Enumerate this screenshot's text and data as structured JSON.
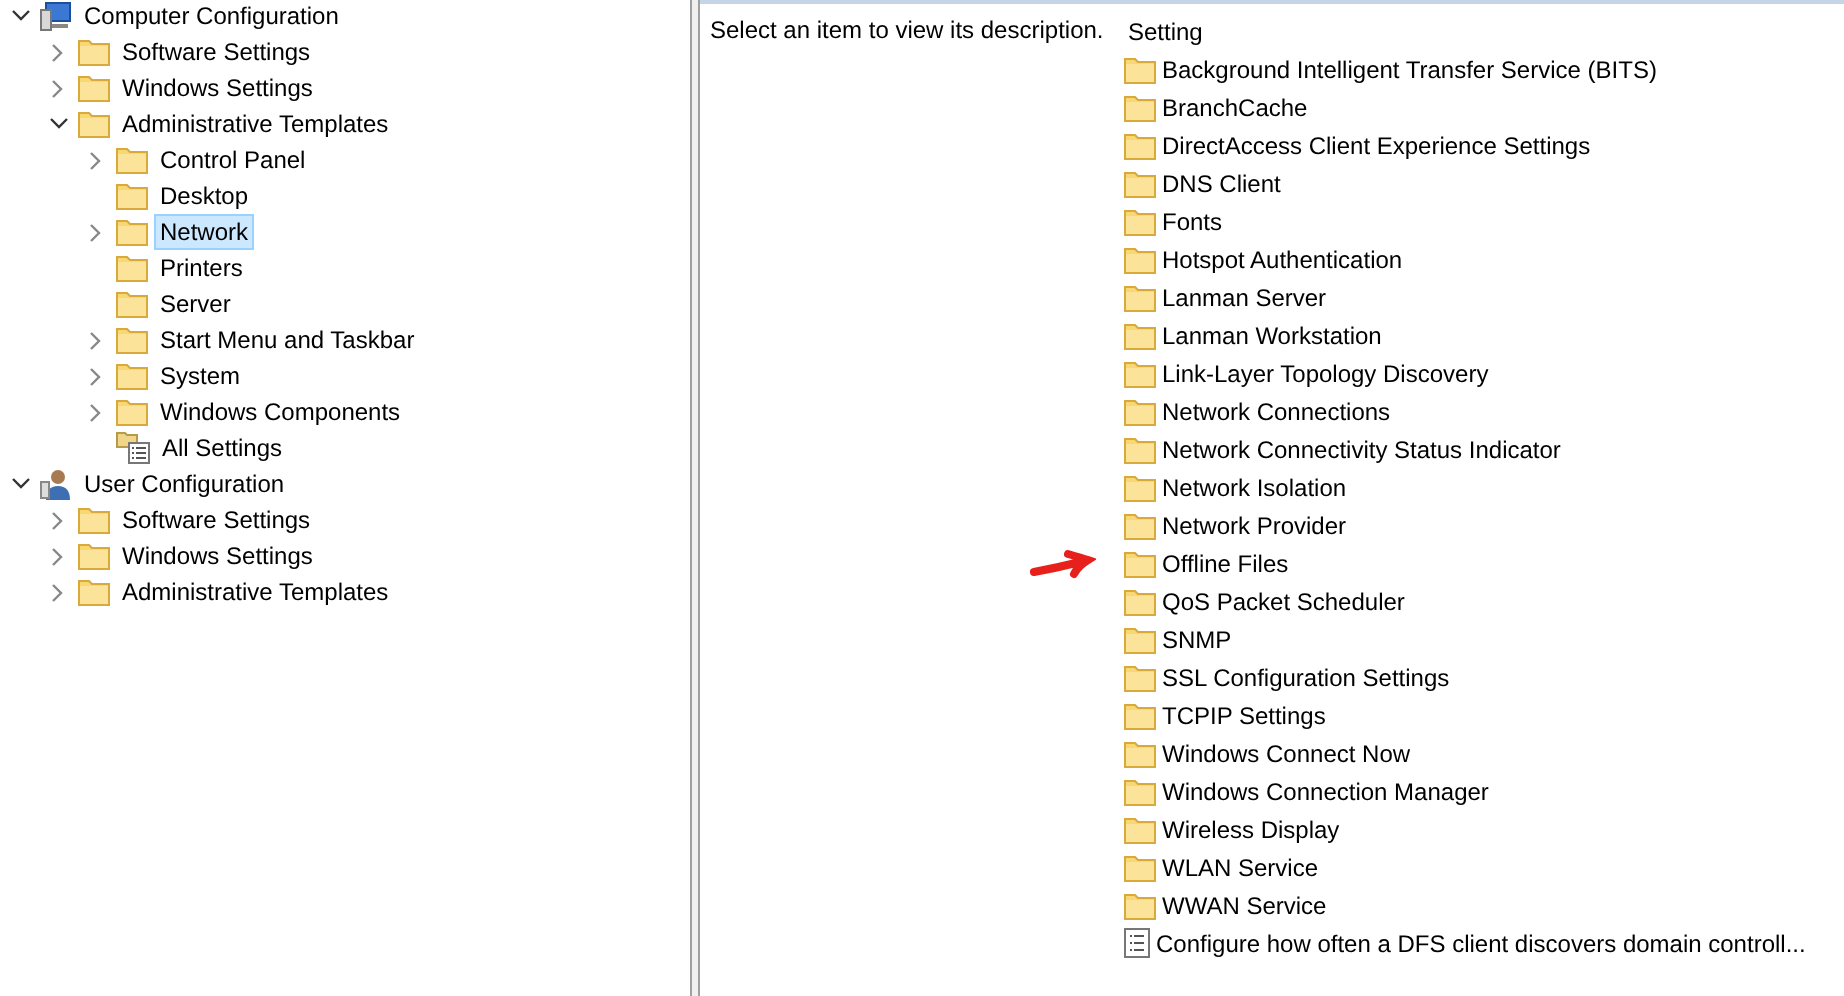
{
  "tree": [
    {
      "label": "Computer Configuration",
      "kind": "computer",
      "expanded": true,
      "selected": false,
      "children": [
        {
          "label": "Software Settings",
          "kind": "folder",
          "expanded": false,
          "selected": false
        },
        {
          "label": "Windows Settings",
          "kind": "folder",
          "expanded": false,
          "selected": false
        },
        {
          "label": "Administrative Templates",
          "kind": "folder",
          "expanded": true,
          "selected": false,
          "children": [
            {
              "label": "Control Panel",
              "kind": "folder",
              "expanded": false,
              "selected": false
            },
            {
              "label": "Desktop",
              "kind": "folder",
              "selected": false
            },
            {
              "label": "Network",
              "kind": "folder",
              "expanded": false,
              "selected": true
            },
            {
              "label": "Printers",
              "kind": "folder",
              "selected": false
            },
            {
              "label": "Server",
              "kind": "folder",
              "selected": false
            },
            {
              "label": "Start Menu and Taskbar",
              "kind": "folder",
              "expanded": false,
              "selected": false
            },
            {
              "label": "System",
              "kind": "folder",
              "expanded": false,
              "selected": false
            },
            {
              "label": "Windows Components",
              "kind": "folder",
              "expanded": false,
              "selected": false
            },
            {
              "label": "All Settings",
              "kind": "settings",
              "selected": false
            }
          ]
        }
      ]
    },
    {
      "label": "User Configuration",
      "kind": "user",
      "expanded": true,
      "selected": false,
      "children": [
        {
          "label": "Software Settings",
          "kind": "folder",
          "expanded": false,
          "selected": false
        },
        {
          "label": "Windows Settings",
          "kind": "folder",
          "expanded": false,
          "selected": false
        },
        {
          "label": "Administrative Templates",
          "kind": "folder",
          "expanded": false,
          "selected": false
        }
      ]
    }
  ],
  "description": "Select an item to view its description.",
  "settings": {
    "column": "Setting",
    "items": [
      {
        "label": "Background Intelligent Transfer Service (BITS)",
        "kind": "folder",
        "marked": false
      },
      {
        "label": "BranchCache",
        "kind": "folder",
        "marked": false
      },
      {
        "label": "DirectAccess Client Experience Settings",
        "kind": "folder",
        "marked": false
      },
      {
        "label": "DNS Client",
        "kind": "folder",
        "marked": false
      },
      {
        "label": "Fonts",
        "kind": "folder",
        "marked": false
      },
      {
        "label": "Hotspot Authentication",
        "kind": "folder",
        "marked": false
      },
      {
        "label": "Lanman Server",
        "kind": "folder",
        "marked": false
      },
      {
        "label": "Lanman Workstation",
        "kind": "folder",
        "marked": false
      },
      {
        "label": "Link-Layer Topology Discovery",
        "kind": "folder",
        "marked": false
      },
      {
        "label": "Network Connections",
        "kind": "folder",
        "marked": false
      },
      {
        "label": "Network Connectivity Status Indicator",
        "kind": "folder",
        "marked": false
      },
      {
        "label": "Network Isolation",
        "kind": "folder",
        "marked": false
      },
      {
        "label": "Network Provider",
        "kind": "folder",
        "marked": false
      },
      {
        "label": "Offline Files",
        "kind": "folder",
        "marked": true
      },
      {
        "label": "QoS Packet Scheduler",
        "kind": "folder",
        "marked": false
      },
      {
        "label": "SNMP",
        "kind": "folder",
        "marked": false
      },
      {
        "label": "SSL Configuration Settings",
        "kind": "folder",
        "marked": false
      },
      {
        "label": "TCPIP Settings",
        "kind": "folder",
        "marked": false
      },
      {
        "label": "Windows Connect Now",
        "kind": "folder",
        "marked": false
      },
      {
        "label": "Windows Connection Manager",
        "kind": "folder",
        "marked": false
      },
      {
        "label": "Wireless Display",
        "kind": "folder",
        "marked": false
      },
      {
        "label": "WLAN Service",
        "kind": "folder",
        "marked": false
      },
      {
        "label": "WWAN Service",
        "kind": "folder",
        "marked": false
      },
      {
        "label": "Configure how often a DFS client discovers domain controll...",
        "kind": "policy",
        "marked": false
      }
    ]
  }
}
